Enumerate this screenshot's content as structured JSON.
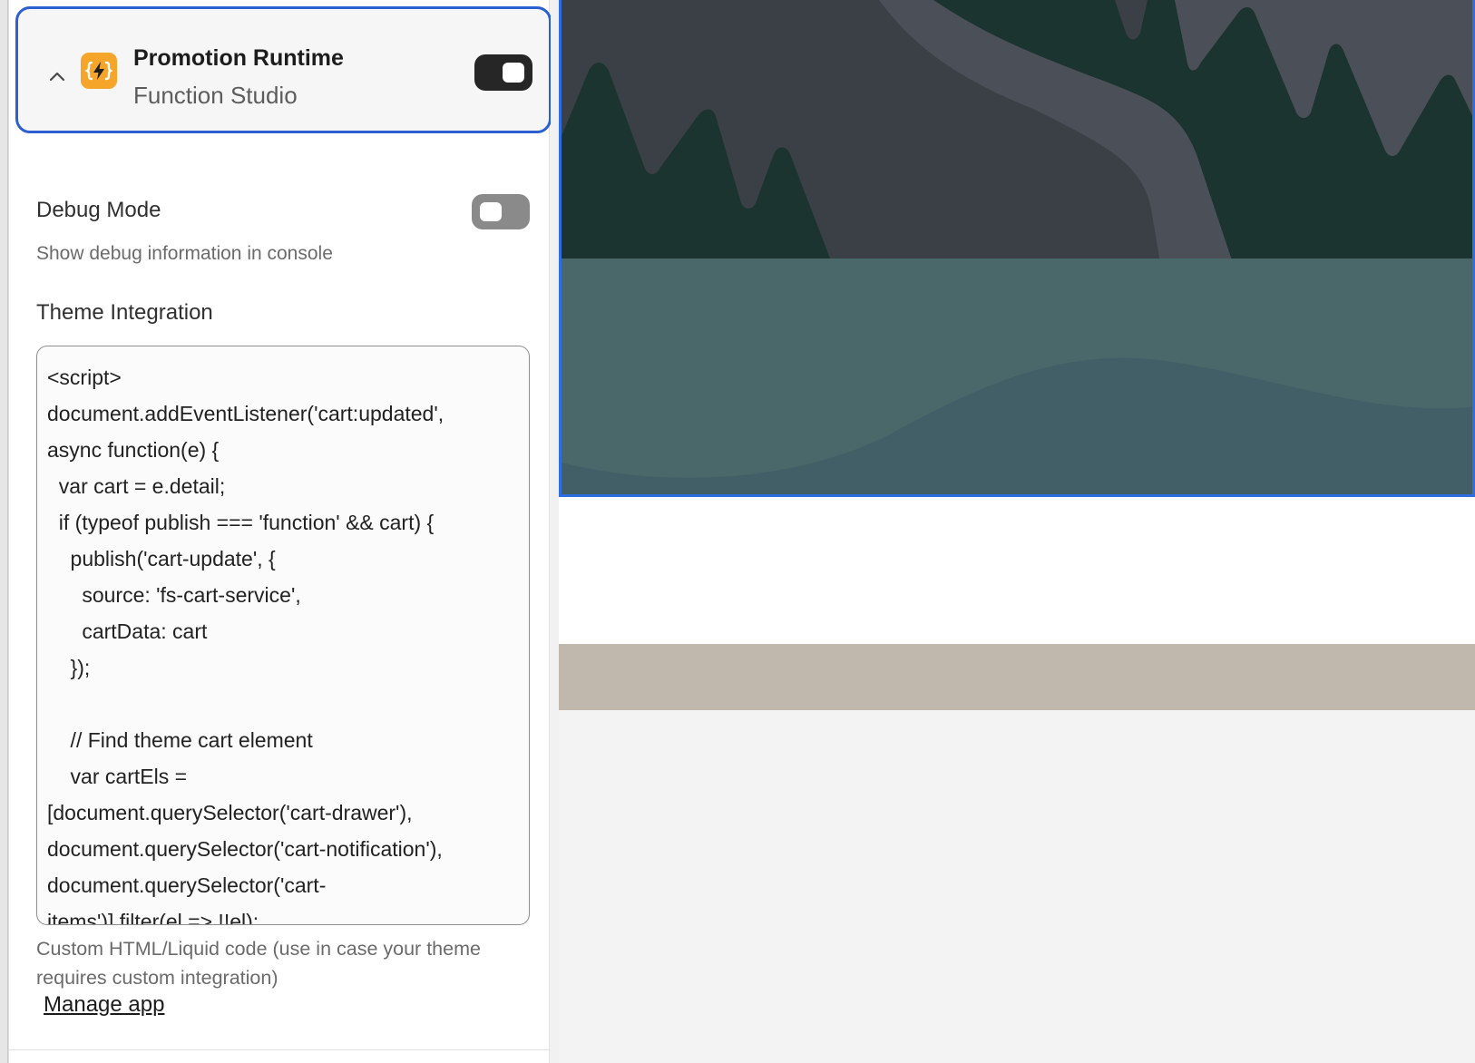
{
  "app": {
    "title": "Promotion Runtime",
    "subtitle": "Function Studio",
    "icon": "function-bolt-icon",
    "enabled": true
  },
  "debug": {
    "label": "Debug Mode",
    "help": "Show debug information in console",
    "enabled": false
  },
  "theme": {
    "label": "Theme Integration",
    "code_lines": [
      "<script>",
      "document.addEventListener('cart:updated',",
      "async function(e) {",
      "  var cart = e.detail;",
      "  if (typeof publish === 'function' && cart) {",
      "    publish('cart-update', {",
      "      source: 'fs-cart-service',",
      "      cartData: cart",
      "    });",
      "",
      "    // Find theme cart element",
      "    var cartEls =",
      "[document.querySelector('cart-drawer'),",
      "document.querySelector('cart-notification'),",
      "document.querySelector('cart-",
      "items')].filter(el => !!el);"
    ],
    "help": "Custom HTML/Liquid code (use in case your theme requires custom integration)"
  },
  "links": {
    "manage_app": "Manage app"
  },
  "colors": {
    "accent_border": "#2c5fd0",
    "app_icon_bg": "#f6a52b",
    "toggle_on": "#262626",
    "toggle_off": "#8a8a8a",
    "tan_band": "#c0b7ad"
  }
}
